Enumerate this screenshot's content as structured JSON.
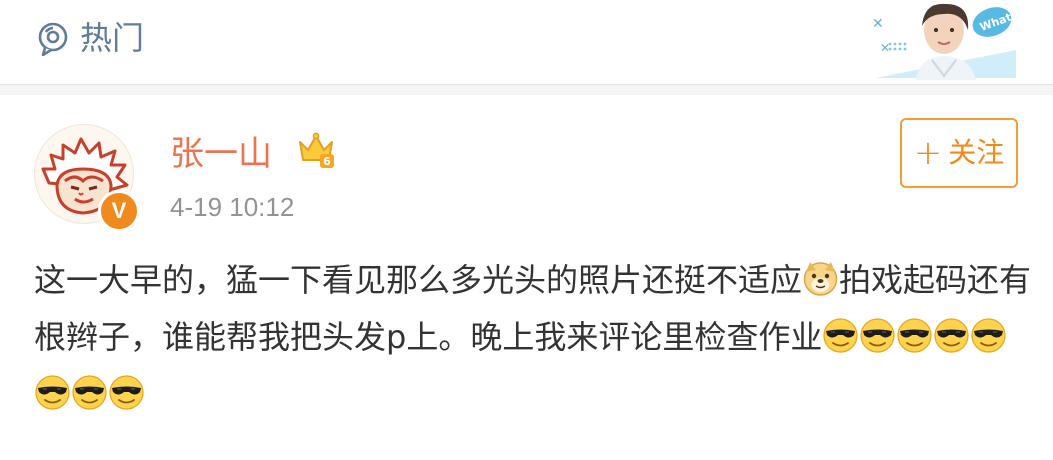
{
  "header": {
    "hot_label": "热门",
    "hot_icon": "location-chat-icon",
    "banner_text": "What"
  },
  "post": {
    "username": "张一山",
    "level_badge": "6",
    "verified_badge": "V",
    "time": "4-19 10:12",
    "follow_button": {
      "plus": "+",
      "label": "关注"
    },
    "text_part1": "这一大早的，猛一下看见那么多光头的照片还挺不适应",
    "text_part2": "拍戏起码还有根辫子，谁能帮我把头发p上。晚上我来评论里检查作业",
    "emoji_doge": "doge-emoji",
    "emoji_cool": "cool-sunglasses-emoji",
    "cool_emoji_count": 8
  },
  "colors": {
    "username": "#eb7350",
    "accent": "#f08a1c",
    "hot_label": "#5f7c99",
    "time": "#939393"
  }
}
